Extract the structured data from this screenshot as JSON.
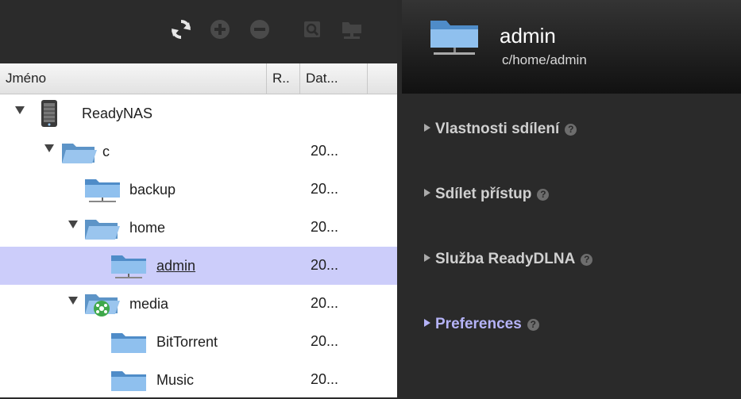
{
  "toolbar": {
    "icons": [
      "refresh-icon",
      "add-icon",
      "remove-icon",
      "search-icon",
      "network-share-icon"
    ]
  },
  "columns": [
    {
      "label": "Jméno"
    },
    {
      "label": "R.."
    },
    {
      "label": "Dat..."
    }
  ],
  "tree": [
    {
      "label": "ReadyNAS",
      "date": "",
      "icon": "nas-device-icon",
      "expanded": true
    },
    {
      "label": "c",
      "date": "20...",
      "icon": "open-folder-icon",
      "expanded": true
    },
    {
      "label": "backup",
      "date": "20...",
      "icon": "shared-folder-icon"
    },
    {
      "label": "home",
      "date": "20...",
      "icon": "open-folder-icon",
      "expanded": true
    },
    {
      "label": "admin",
      "date": "20...",
      "icon": "shared-folder-icon",
      "selected": true
    },
    {
      "label": "media",
      "date": "20...",
      "icon": "media-folder-icon",
      "expanded": true
    },
    {
      "label": "BitTorrent",
      "date": "20...",
      "icon": "folder-icon"
    },
    {
      "label": "Music",
      "date": "20...",
      "icon": "folder-icon"
    }
  ],
  "details": {
    "title": "admin",
    "path": "c/home/admin",
    "icon": "shared-folder-icon",
    "sections": [
      {
        "label": "Vlastnosti sdílení"
      },
      {
        "label": "Sdílet přístup"
      },
      {
        "label": "Služba ReadyDLNA"
      },
      {
        "label": "Preferences",
        "active": true
      }
    ],
    "help_glyph": "?"
  },
  "colors": {
    "selection": "#cccdfa",
    "active_section": "#b5b3f7",
    "panel_dark": "#2a2a2a"
  }
}
